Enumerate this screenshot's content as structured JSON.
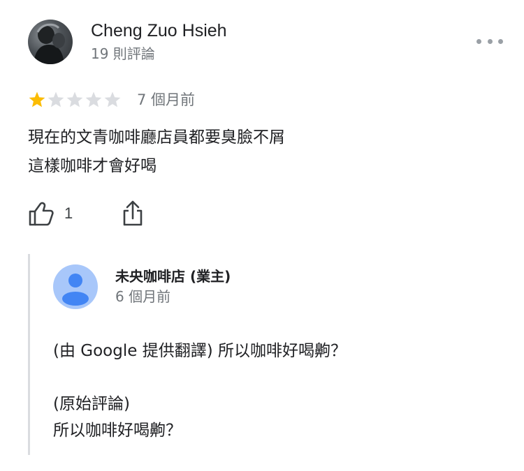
{
  "review": {
    "reviewer_name": "Cheng Zuo Hsieh",
    "review_count": "19 則評論",
    "rating": 1,
    "max_rating": 5,
    "date": "7 個月前",
    "text_lines": [
      "現在的文青咖啡廳店員都要臭臉不屑",
      "這樣咖啡才會好喝"
    ],
    "like_count": "1"
  },
  "owner_reply": {
    "name": "未央咖啡店 (業主)",
    "date": "6 個月前",
    "translated_line": "(由 Google 提供翻譯) 所以咖啡好喝齁？",
    "original_label": "(原始評論)",
    "original_line": "所以咖啡好喝齁？"
  },
  "colors": {
    "star_filled": "#fbbc04",
    "star_empty": "#dadce0",
    "secondary_text": "#70757a",
    "owner_avatar_bg": "#a8c7fa",
    "owner_avatar_fg": "#4285f4"
  },
  "icons": [
    "reviewer-avatar",
    "more-options-icon",
    "star-icon",
    "thumbs-up-icon",
    "share-icon",
    "owner-avatar-icon"
  ]
}
